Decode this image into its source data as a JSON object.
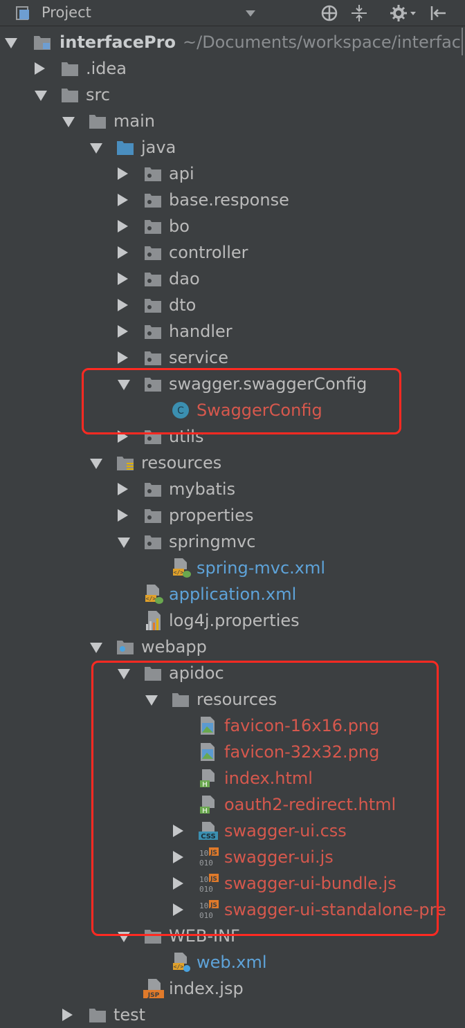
{
  "toolbar": {
    "title": "Project"
  },
  "rows": {
    "r0": {
      "label": "interfacePro",
      "path": "~/Documents/workspace/interfac"
    },
    "r1": {
      "label": ".idea"
    },
    "r2": {
      "label": "src"
    },
    "r3": {
      "label": "main"
    },
    "r4": {
      "label": "java"
    },
    "r5": {
      "label": "api"
    },
    "r6": {
      "label": "base.response"
    },
    "r7": {
      "label": "bo"
    },
    "r8": {
      "label": "controller"
    },
    "r9": {
      "label": "dao"
    },
    "r10": {
      "label": "dto"
    },
    "r11": {
      "label": "handler"
    },
    "r12": {
      "label": "service"
    },
    "r13": {
      "label": "swagger.swaggerConfig"
    },
    "r14": {
      "label": "SwaggerConfig",
      "badge": "C"
    },
    "r15": {
      "label": "utils"
    },
    "r16": {
      "label": "resources"
    },
    "r17": {
      "label": "mybatis"
    },
    "r18": {
      "label": "properties"
    },
    "r19": {
      "label": "springmvc"
    },
    "r20": {
      "label": "spring-mvc.xml"
    },
    "r21": {
      "label": "application.xml"
    },
    "r22": {
      "label": "log4j.properties"
    },
    "r23": {
      "label": "webapp"
    },
    "r24": {
      "label": "apidoc"
    },
    "r25": {
      "label": "resources"
    },
    "r26": {
      "label": "favicon-16x16.png"
    },
    "r27": {
      "label": "favicon-32x32.png"
    },
    "r28": {
      "label": "index.html",
      "badge": "H"
    },
    "r29": {
      "label": "oauth2-redirect.html",
      "badge": "H"
    },
    "r30": {
      "label": "swagger-ui.css",
      "badge": "CSS"
    },
    "r31": {
      "label": "swagger-ui.js",
      "badge": "JS"
    },
    "r32": {
      "label": "swagger-ui-bundle.js",
      "badge": "JS"
    },
    "r33": {
      "label": "swagger-ui-standalone-pre",
      "badge": "JS"
    },
    "r34": {
      "label": "WEB-INF"
    },
    "r35": {
      "label": "web.xml"
    },
    "r36": {
      "label": "index.jsp",
      "badge": "JSP"
    },
    "r37": {
      "label": "test"
    }
  },
  "colors": {
    "background": "#3c3f41",
    "highlight_box": "#ff2a22",
    "modified_file": "#d6584d",
    "xml_file": "#5ea3d9",
    "class_badge": "#3b8fb0"
  }
}
